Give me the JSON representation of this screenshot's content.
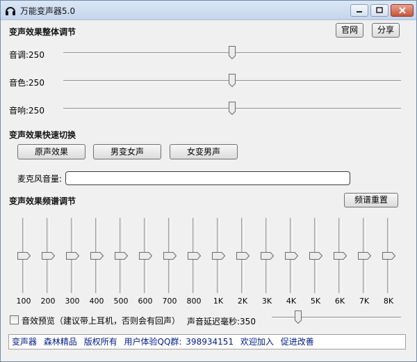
{
  "window": {
    "title": "万能变声器5.0",
    "icon": "headphones-icon",
    "controls": [
      "minimize-icon",
      "maximize-icon",
      "close-icon"
    ]
  },
  "overall": {
    "title": "变声效果整体调节",
    "website_button": "官网",
    "share_button": "分享",
    "sliders": [
      {
        "label": "音调:250",
        "value_fraction": 0.5
      },
      {
        "label": "音色:250",
        "value_fraction": 0.5
      },
      {
        "label": "音响:250",
        "value_fraction": 0.5
      }
    ]
  },
  "quick_switch": {
    "title": "变声效果快速切换",
    "buttons": [
      "原声效果",
      "男变女声",
      "女变男声"
    ]
  },
  "mic": {
    "label": "麦克风音量:",
    "level_fraction": 0
  },
  "equalizer": {
    "title": "变声效果频谱调节",
    "reset_button": "频谱重置",
    "bands": [
      {
        "label": "100",
        "value_fraction": 0.5
      },
      {
        "label": "200",
        "value_fraction": 0.5
      },
      {
        "label": "300",
        "value_fraction": 0.5
      },
      {
        "label": "400",
        "value_fraction": 0.5
      },
      {
        "label": "500",
        "value_fraction": 0.5
      },
      {
        "label": "600",
        "value_fraction": 0.5
      },
      {
        "label": "700",
        "value_fraction": 0.5
      },
      {
        "label": "800",
        "value_fraction": 0.5
      },
      {
        "label": "1K",
        "value_fraction": 0.5
      },
      {
        "label": "2K",
        "value_fraction": 0.5
      },
      {
        "label": "3K",
        "value_fraction": 0.5
      },
      {
        "label": "4K",
        "value_fraction": 0.5
      },
      {
        "label": "5K",
        "value_fraction": 0.5
      },
      {
        "label": "6K",
        "value_fraction": 0.5
      },
      {
        "label": "7K",
        "value_fraction": 0.5
      },
      {
        "label": "8K",
        "value_fraction": 0.5
      }
    ]
  },
  "preview": {
    "checkbox_label": "音效预览（建议带上耳机，否则会有回声）",
    "checked": false,
    "delay_label": "声音延迟毫秒:350",
    "delay_fraction": 0.19
  },
  "status_bar": {
    "segments": [
      "变声器",
      "森林精品",
      "版权所有",
      "用户体验QQ群:",
      "398934151",
      "欢迎加入",
      "促进改善"
    ]
  }
}
